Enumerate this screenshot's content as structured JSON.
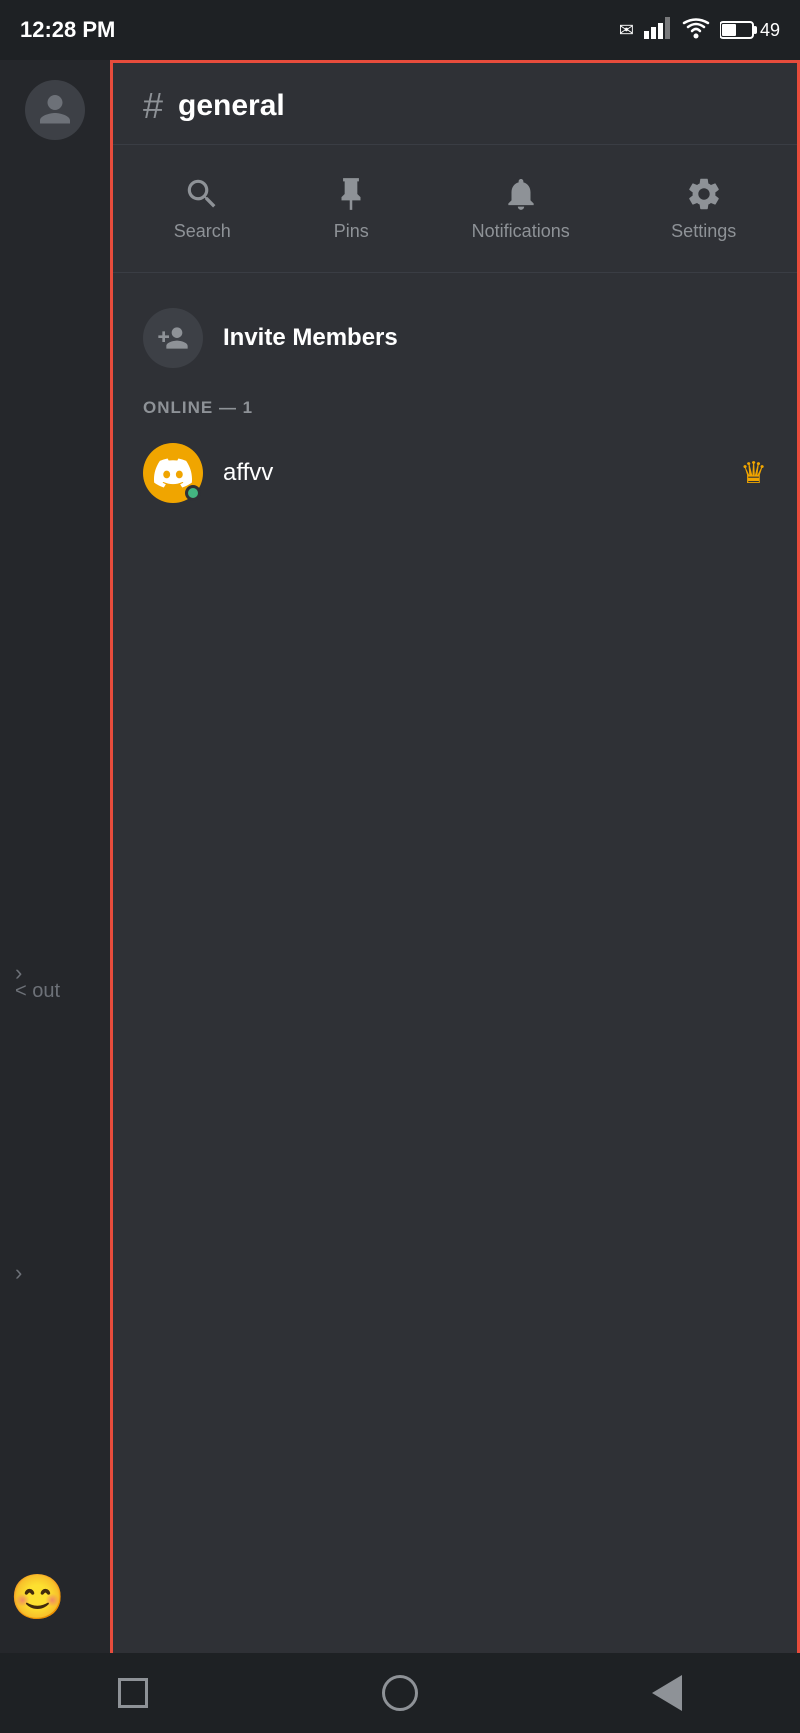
{
  "statusBar": {
    "time": "12:28 PM",
    "battery": "49"
  },
  "channel": {
    "name": "general",
    "hash": "#"
  },
  "actions": [
    {
      "id": "search",
      "label": "Search"
    },
    {
      "id": "pins",
      "label": "Pins"
    },
    {
      "id": "notifications",
      "label": "Notifications"
    },
    {
      "id": "settings",
      "label": "Settings"
    }
  ],
  "inviteMembers": {
    "label": "Invite Members"
  },
  "onlineSection": {
    "header": "ONLINE — 1"
  },
  "members": [
    {
      "name": "affvv",
      "status": "online",
      "isOwner": true
    }
  ],
  "sidebar": {
    "profileLabel": "Profile"
  },
  "leftEdgeText": "< out",
  "navBar": {
    "squareLabel": "Square",
    "circleLabel": "Circle",
    "triangleLabel": "Back"
  }
}
